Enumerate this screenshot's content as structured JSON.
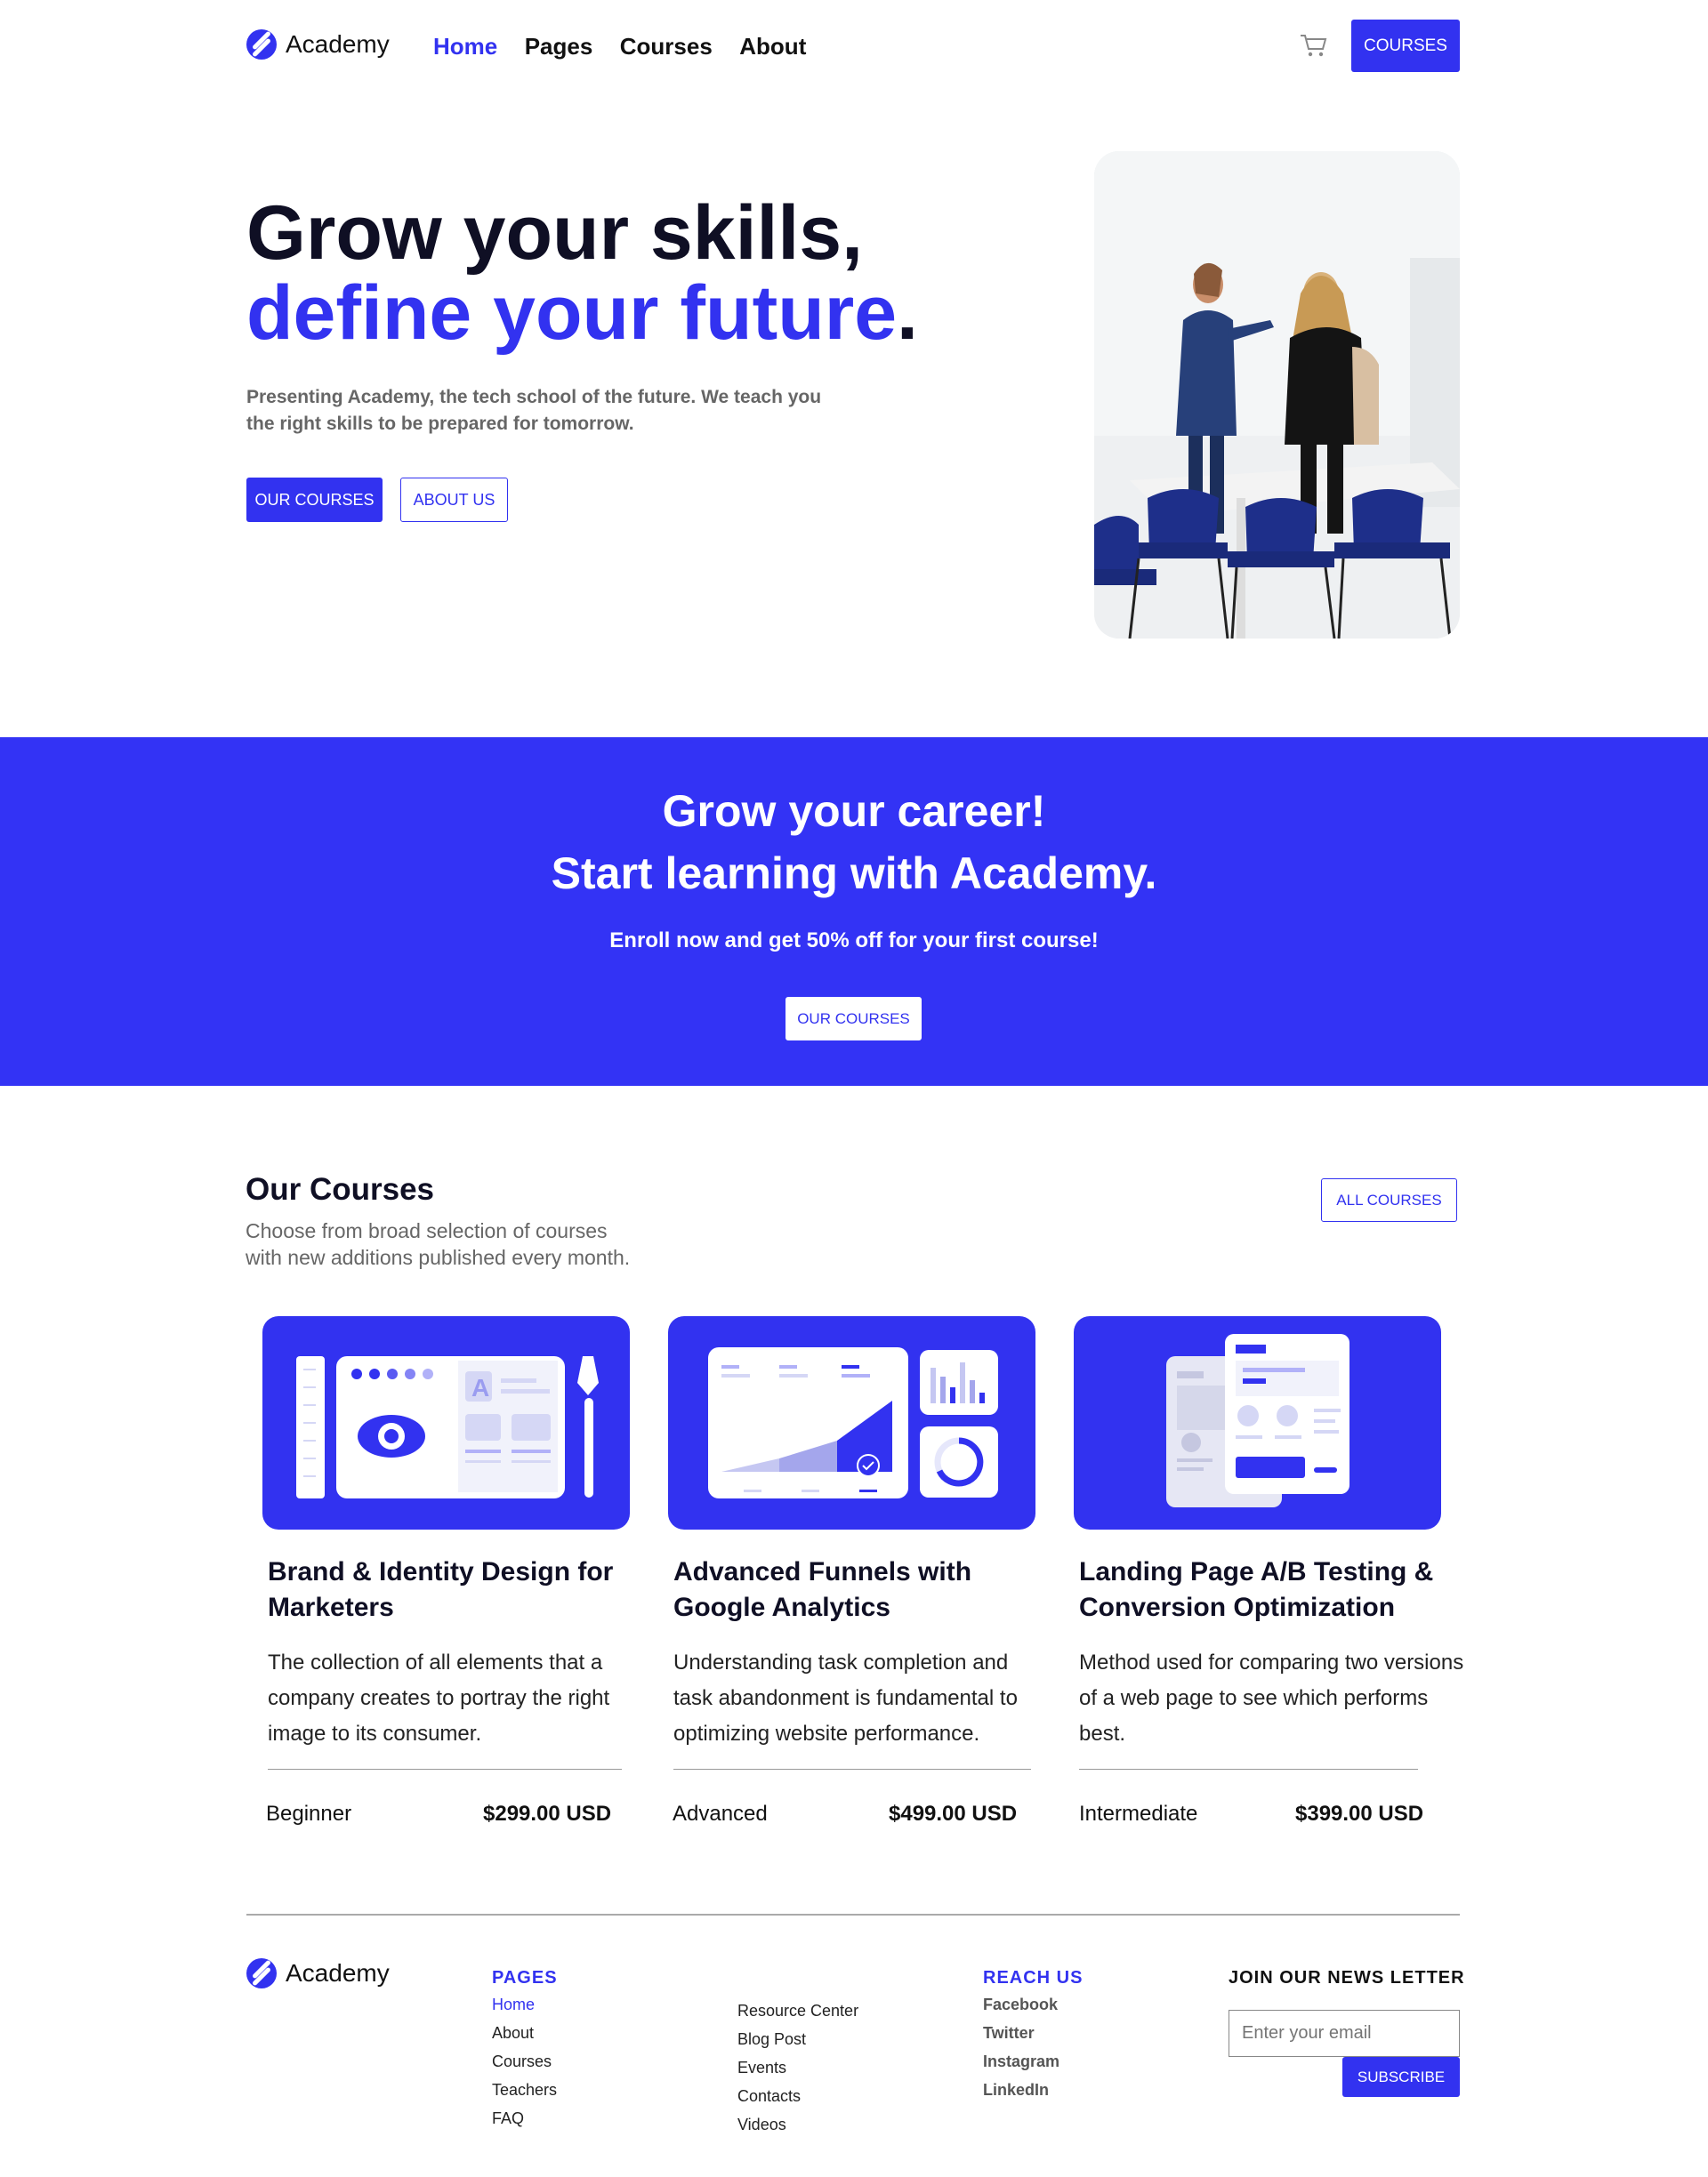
{
  "header": {
    "brand": "Academy",
    "nav": [
      "Home",
      "Pages",
      "Courses",
      "About"
    ],
    "courses_button": "COURSES"
  },
  "hero": {
    "title_line1": "Grow your skills,",
    "title_line2": "define your future",
    "title_period": ".",
    "subtitle": "Presenting Academy, the tech school of the future. We teach you the right skills to be prepared for tomorrow.",
    "primary_button": "OUR COURSES",
    "secondary_button": "ABOUT US"
  },
  "promo": {
    "title_line1": "Grow your career!",
    "title_line2": "Start learning with Academy.",
    "subtitle": "Enroll now and get 50% off for your first course!",
    "button": "OUR COURSES"
  },
  "courses": {
    "title": "Our Courses",
    "subtitle_line1": "Choose from broad selection of courses",
    "subtitle_line2": "with new additions published every month.",
    "all_button": "ALL COURSES",
    "items": [
      {
        "title": "Brand & Identity Design for Marketers",
        "description": "The collection of all elements that a company creates to portray the right image to its consumer.",
        "level": "Beginner",
        "price": "$299.00 USD"
      },
      {
        "title": "Advanced Funnels with Google Analytics",
        "description": "Understanding task completion and task abandonment is fundamental to optimizing website performance.",
        "level": "Advanced",
        "price": "$499.00 USD"
      },
      {
        "title": "Landing Page A/B Testing & Conversion Optimization",
        "description": "Method used for comparing two versions of a web page to see which performs best.",
        "level": "Intermediate",
        "price": "$399.00 USD"
      }
    ]
  },
  "footer": {
    "brand": "Academy",
    "pages_heading": "PAGES",
    "pages_links": [
      "Home",
      "About",
      "Courses",
      "Teachers",
      "FAQ"
    ],
    "more_links": [
      "Resource Center",
      "Blog Post",
      "Events",
      "Contacts",
      "Videos"
    ],
    "reach_heading": "REACH US",
    "reach_links": [
      "Facebook",
      "Twitter",
      "Instagram",
      "LinkedIn"
    ],
    "newsletter_heading": "JOIN OUR NEWS LETTER",
    "email_placeholder": "Enter your email",
    "subscribe_button": "SUBSCRIBE"
  },
  "colors": {
    "accent": "#3232f0",
    "text": "#0f0f24",
    "muted": "#666666"
  }
}
